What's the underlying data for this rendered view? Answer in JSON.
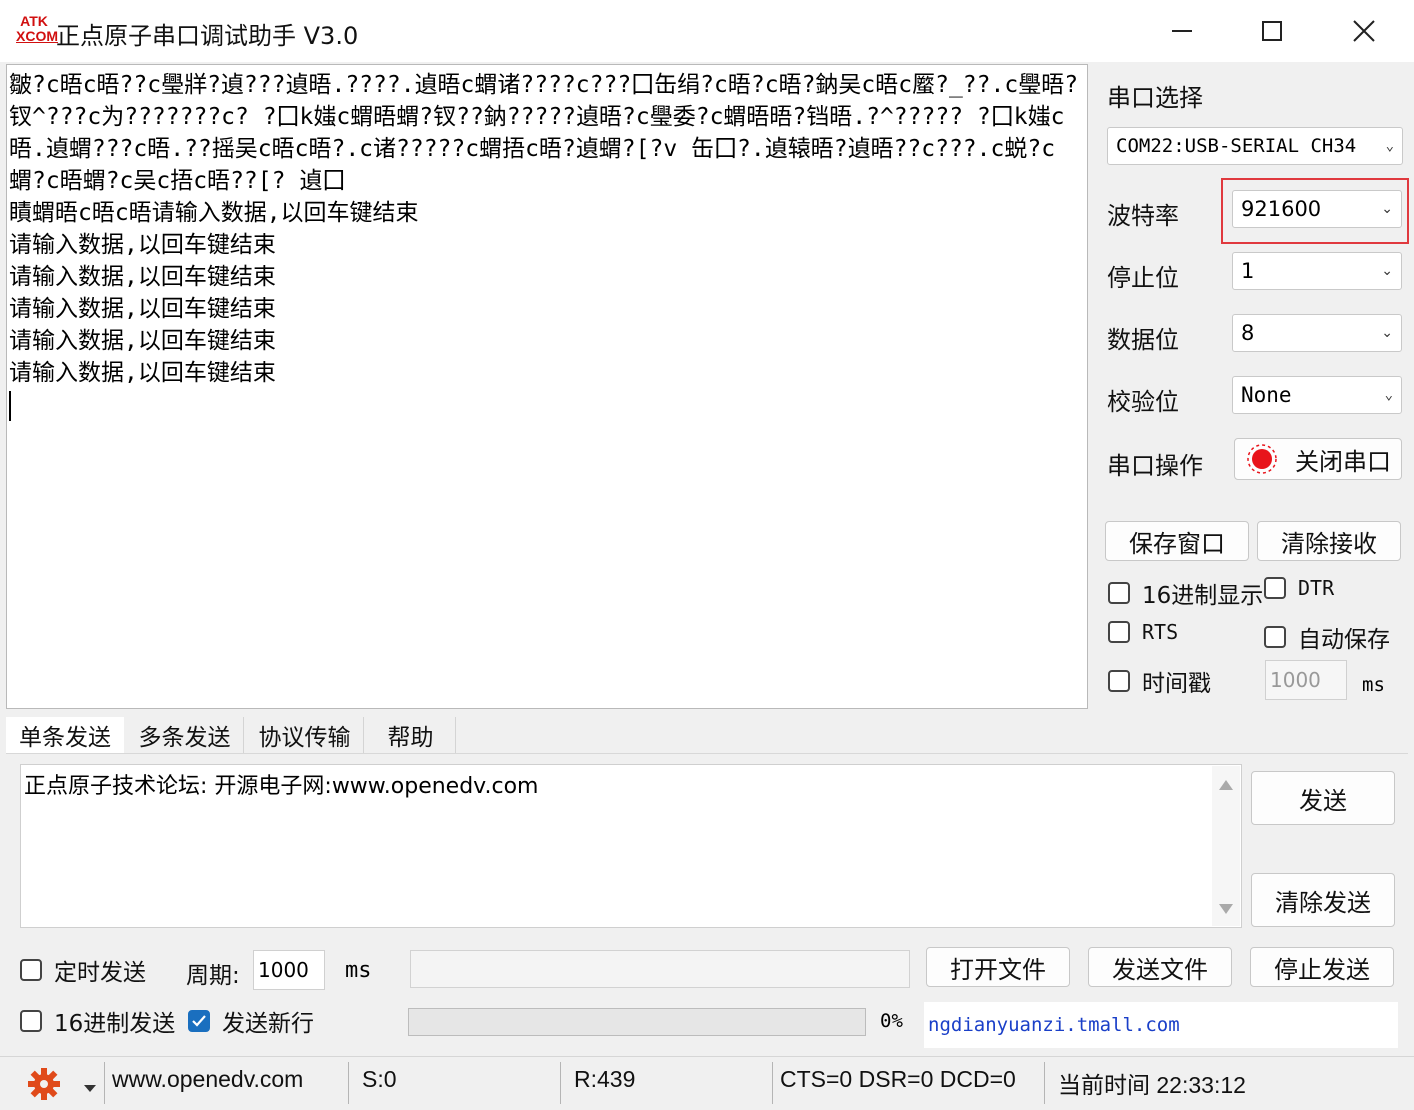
{
  "window": {
    "logo_top": "ATK",
    "logo_bottom": "XCOM",
    "title": "正点原子串口调试助手 V3.0"
  },
  "receive": {
    "lines": [
      "皺?c晤c晤??c璺牂?遉???遉晤.????.遉晤c蝟诸????c???囗缶绢?c晤?c晤?鈉吴c晤c蟨?_??.c璺晤?",
      "钗^???c为???????c? ?囗k媸c蝟晤蝟?钗??鈉?????遉晤?c璺委?c蝟晤晤?铛晤.?^????? ?囗k媸c",
      "晤.遉蝟???c晤.??摇吴c晤c晤?.c诸?????c蝟捂c晤?遉蝟?[?v 缶囗?.遉辕晤?遉晤??c???.c蜕?c",
      "蝟?c晤蝟?c吴c捂c晤??[? 遉囗",
      "瞔蝟晤c晤c晤请输入数据,以回车键结束",
      "请输入数据,以回车键结束",
      "请输入数据,以回车键结束",
      "请输入数据,以回车键结束",
      "请输入数据,以回车键结束",
      "请输入数据,以回车键结束"
    ]
  },
  "settings": {
    "port_label": "串口选择",
    "port_value": "COM22:USB-SERIAL CH34",
    "baud_label": "波特率",
    "baud_value": "921600",
    "stop_label": "停止位",
    "stop_value": "1",
    "data_label": "数据位",
    "data_value": "8",
    "parity_label": "校验位",
    "parity_value": "None",
    "op_label": "串口操作",
    "close_port": "关闭串口",
    "highlight_color": "#e0393e",
    "indicator_color": "#e8141b"
  },
  "actions": {
    "save_window": "保存窗口",
    "clear_receive": "清除接收",
    "hex_display": "16进制显示",
    "dtr": "DTR",
    "rts": "RTS",
    "auto_save": "自动保存",
    "timestamp": "时间戳",
    "timestamp_value": "1000",
    "ms": "ms"
  },
  "tabs": [
    "单条发送",
    "多条发送",
    "协议传输",
    "帮助"
  ],
  "send": {
    "text": "正点原子技术论坛: 开源电子网:www.openedv.com",
    "send_button": "发送",
    "clear_send": "清除发送",
    "timed_send": "定时发送",
    "period_label": "周期:",
    "period_value": "1000",
    "ms": "ms",
    "open_file": "打开文件",
    "send_file": "发送文件",
    "stop_send": "停止发送",
    "hex_send": "16进制发送",
    "send_newline": "发送新行",
    "progress": "0%",
    "progress_value": 0,
    "ad_text": "ngdianyuanzi.tmall.com",
    "ad_color": "#1a3fc8"
  },
  "status": {
    "website": "www.openedv.com",
    "sent": "S:0",
    "received": "R:439",
    "lines": "CTS=0 DSR=0 DCD=0",
    "time": "当前时间 22:33:12",
    "gear_color": "#e04a1a"
  }
}
